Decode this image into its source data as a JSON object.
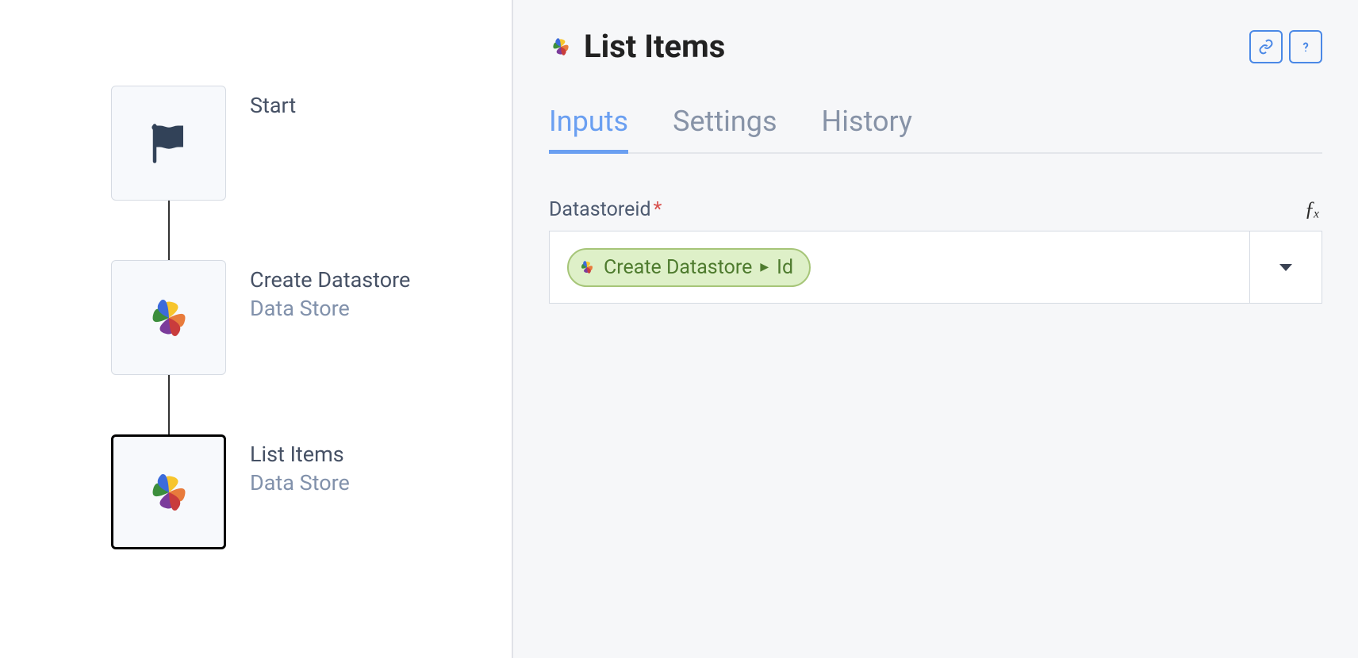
{
  "flow": {
    "nodes": [
      {
        "title": "Start",
        "subtitle": "",
        "icon": "flag"
      },
      {
        "title": "Create Datastore",
        "subtitle": "Data Store",
        "icon": "pinwheel"
      },
      {
        "title": "List Items",
        "subtitle": "Data Store",
        "icon": "pinwheel"
      }
    ]
  },
  "panel": {
    "title": "List Items",
    "tabs": [
      {
        "label": "Inputs",
        "active": true
      },
      {
        "label": "Settings",
        "active": false
      },
      {
        "label": "History",
        "active": false
      }
    ],
    "field": {
      "label": "Datastoreid",
      "required_marker": "*",
      "chip_source": "Create Datastore",
      "chip_field": "Id"
    },
    "fx_label": "ƒₓ"
  }
}
